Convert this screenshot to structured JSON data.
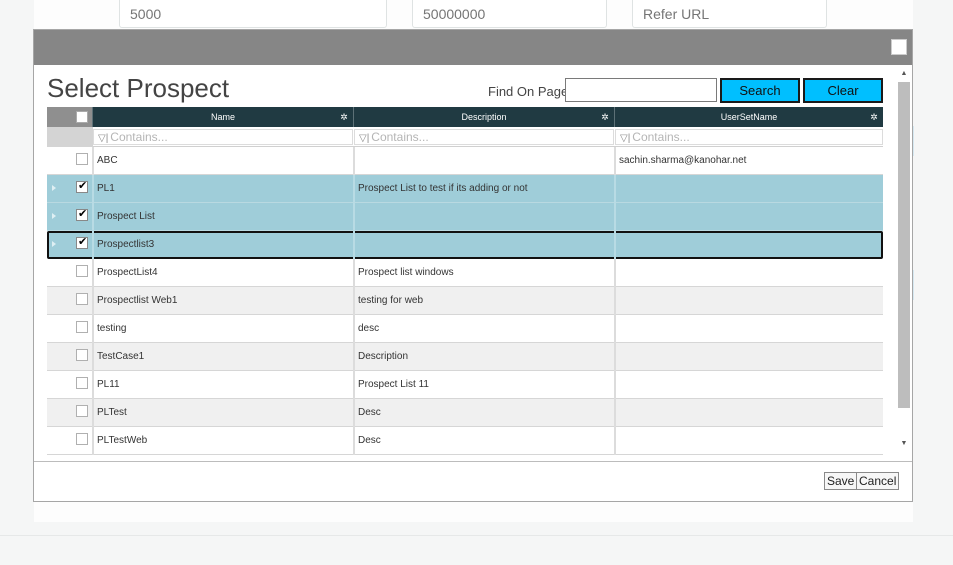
{
  "background": {
    "inputs": [
      {
        "placeholder": "5000"
      },
      {
        "placeholder": "50000000"
      },
      {
        "placeholder": "Refer URL"
      }
    ]
  },
  "dialog": {
    "title": "Select Prospect",
    "find_label": "Find On Page",
    "find_value": "",
    "search_label": "Search",
    "clear_label": "Clear",
    "save_label": "Save",
    "cancel_label": "Cancel",
    "close_icon": "close-icon"
  },
  "grid": {
    "columns": [
      "Name",
      "Description",
      "UserSetName"
    ],
    "filter_placeholder": "Contains...",
    "rows": [
      {
        "name": "ABC",
        "description": "",
        "usersetname": "sachin.sharma@kanohar.net",
        "checked": false,
        "selected": false
      },
      {
        "name": "PL1",
        "description": "Prospect List to test if its adding or not",
        "usersetname": "",
        "checked": true,
        "selected": true
      },
      {
        "name": "Prospect List",
        "description": "",
        "usersetname": "",
        "checked": true,
        "selected": true
      },
      {
        "name": "Prospectlist3",
        "description": "",
        "usersetname": "",
        "checked": true,
        "selected": true
      },
      {
        "name": "ProspectList4",
        "description": "Prospect list windows",
        "usersetname": "",
        "checked": false,
        "selected": false
      },
      {
        "name": "Prospectlist Web1",
        "description": "testing for web",
        "usersetname": "",
        "checked": false,
        "selected": false
      },
      {
        "name": "testing",
        "description": "desc",
        "usersetname": "",
        "checked": false,
        "selected": false
      },
      {
        "name": "TestCase1",
        "description": "Description",
        "usersetname": "",
        "checked": false,
        "selected": false
      },
      {
        "name": "PL11",
        "description": "Prospect List 11",
        "usersetname": "",
        "checked": false,
        "selected": false
      },
      {
        "name": "PLTest",
        "description": "Desc",
        "usersetname": "",
        "checked": false,
        "selected": false
      },
      {
        "name": "PLTestWeb",
        "description": "Desc",
        "usersetname": "",
        "checked": false,
        "selected": false
      }
    ]
  },
  "colors": {
    "header_bg": "#203a42",
    "selected_row": "#9fcdd9",
    "button_blue": "#00bfff",
    "titlebar": "#868686"
  }
}
